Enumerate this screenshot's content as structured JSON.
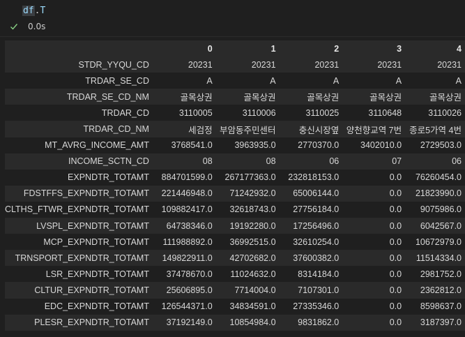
{
  "cell": {
    "code_var": "df",
    "code_dot": ".",
    "code_attr": "T",
    "status_time": "0.0s",
    "status_icon": "check-icon",
    "accent_color": "#89d185"
  },
  "table": {
    "columns": [
      "0",
      "1",
      "2",
      "3",
      "4"
    ],
    "rows": [
      {
        "label": "STDR_YYQU_CD",
        "values": [
          "20231",
          "20231",
          "20231",
          "20231",
          "20231"
        ]
      },
      {
        "label": "TRDAR_SE_CD",
        "values": [
          "A",
          "A",
          "A",
          "A",
          "A"
        ]
      },
      {
        "label": "TRDAR_SE_CD_NM",
        "values": [
          "골목상권",
          "골목상권",
          "골목상권",
          "골목상권",
          "골목상권"
        ]
      },
      {
        "label": "TRDAR_CD",
        "values": [
          "3110005",
          "3110006",
          "3110025",
          "3110648",
          "3110026"
        ]
      },
      {
        "label": "TRDAR_CD_NM",
        "values": [
          "세검정",
          "부암동주민센터",
          "충신시장옆",
          "양천향교역 7번",
          "종로5가역 4번"
        ]
      },
      {
        "label": "MT_AVRG_INCOME_AMT",
        "values": [
          "3768541.0",
          "3963935.0",
          "2770370.0",
          "3402010.0",
          "2729503.0"
        ]
      },
      {
        "label": "INCOME_SCTN_CD",
        "values": [
          "08",
          "08",
          "06",
          "07",
          "06"
        ]
      },
      {
        "label": "EXPNDTR_TOTAMT",
        "values": [
          "884701599.0",
          "267177363.0",
          "232818153.0",
          "0.0",
          "76260454.0"
        ]
      },
      {
        "label": "FDSTFFS_EXPNDTR_TOTAMT",
        "values": [
          "221446948.0",
          "71242932.0",
          "65006144.0",
          "0.0",
          "21823990.0"
        ]
      },
      {
        "label": "CLTHS_FTWR_EXPNDTR_TOTAMT",
        "values": [
          "109882417.0",
          "32618743.0",
          "27756184.0",
          "0.0",
          "9075986.0"
        ]
      },
      {
        "label": "LVSPL_EXPNDTR_TOTAMT",
        "values": [
          "64738346.0",
          "19192280.0",
          "17256496.0",
          "0.0",
          "6042567.0"
        ]
      },
      {
        "label": "MCP_EXPNDTR_TOTAMT",
        "values": [
          "111988892.0",
          "36992515.0",
          "32610254.0",
          "0.0",
          "10672979.0"
        ]
      },
      {
        "label": "TRNSPORT_EXPNDTR_TOTAMT",
        "values": [
          "149822911.0",
          "42702682.0",
          "37600382.0",
          "0.0",
          "11514334.0"
        ]
      },
      {
        "label": "LSR_EXPNDTR_TOTAMT",
        "values": [
          "37478670.0",
          "11024632.0",
          "8314184.0",
          "0.0",
          "2981752.0"
        ]
      },
      {
        "label": "CLTUR_EXPNDTR_TOTAMT",
        "values": [
          "25606895.0",
          "7714004.0",
          "7107301.0",
          "0.0",
          "2362812.0"
        ]
      },
      {
        "label": "EDC_EXPNDTR_TOTAMT",
        "values": [
          "126544371.0",
          "34834591.0",
          "27335346.0",
          "0.0",
          "8598637.0"
        ]
      },
      {
        "label": "PLESR_EXPNDTR_TOTAMT",
        "values": [
          "37192149.0",
          "10854984.0",
          "9831862.0",
          "0.0",
          "3187397.0"
        ]
      }
    ]
  }
}
